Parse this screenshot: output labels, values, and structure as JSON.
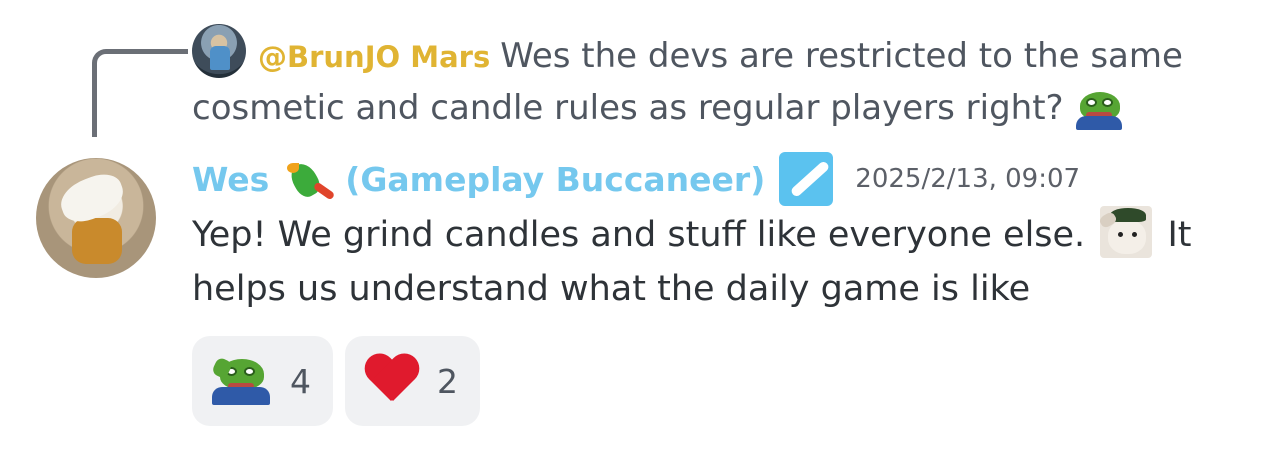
{
  "reply": {
    "author": "@BrunJO Mars",
    "text_line1": "Wes the devs are restricted to the same",
    "text_line2": "cosmetic and candle rules as regular players right?",
    "emoji": "pepe-peek-emoji"
  },
  "message": {
    "author_name": "Wes",
    "author_role": "(Gameplay Buccaneer)",
    "author_emoji": "parrot-emoji",
    "role_badge_icon": "feather-badge-icon",
    "timestamp": "2025/2/13, 09:07",
    "body_part1": "Yep! We grind candles and stuff like everyone else.",
    "body_emoji": "cat-salute-emoji",
    "body_part2": " It",
    "body_line2": "helps us understand what the daily game is like",
    "colors": {
      "author": "#75c8ee",
      "reply_author": "#e0b433"
    }
  },
  "reactions": [
    {
      "emoji": "pepe-salute-emoji",
      "count": "4"
    },
    {
      "emoji": "red-heart-emoji",
      "count": "2"
    }
  ]
}
